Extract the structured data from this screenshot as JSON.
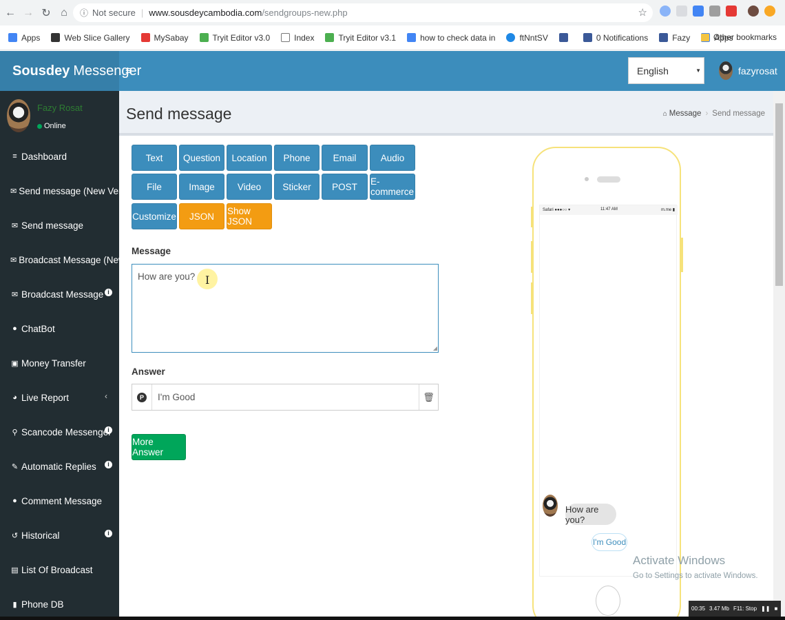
{
  "browser": {
    "security": "Not secure",
    "host": "www.sousdeycambodia.com",
    "path": "/sendgroups-new.php"
  },
  "bookmarks": [
    {
      "label": "Apps",
      "color": "#4285f4"
    },
    {
      "label": "Web Slice Gallery",
      "color": "#333333"
    },
    {
      "label": "MySabay",
      "color": "#e53935"
    },
    {
      "label": "Tryit Editor v3.0",
      "color": "#4caf50"
    },
    {
      "label": "Index",
      "color": "#ffffff"
    },
    {
      "label": "Tryit Editor v3.1",
      "color": "#4caf50"
    },
    {
      "label": "how to check data in",
      "color": "#4285f4"
    },
    {
      "label": "ftNntSV",
      "color": "#1e88e5"
    },
    {
      "label": "",
      "color": "#3b5998"
    },
    {
      "label": "0 Notifications",
      "color": "#3b5998"
    },
    {
      "label": "Fazy",
      "color": "#3b5998"
    },
    {
      "label": "Apps",
      "color": "#4285f4"
    }
  ],
  "other_bookmarks": "Other bookmarks",
  "header": {
    "logo_bold": "Sousdey",
    "logo_rest": "Messenger",
    "language": "English",
    "username": "fazyrosat"
  },
  "sidebar": {
    "user_name": "Fazy Rosat",
    "status": "Online",
    "items": [
      {
        "label": "Dashboard",
        "icon": "≡"
      },
      {
        "label": "Send message (New Version)",
        "icon": "✉"
      },
      {
        "label": "Send message",
        "icon": "✉"
      },
      {
        "label": "Broadcast Message (New Vers",
        "icon": "✉"
      },
      {
        "label": "Broadcast Message",
        "icon": "✉"
      },
      {
        "label": "ChatBot",
        "icon": "●"
      },
      {
        "label": "Money Transfer",
        "icon": "▣"
      },
      {
        "label": "Live Report",
        "icon": "◕"
      },
      {
        "label": "Scancode Messenger",
        "icon": "⚲"
      },
      {
        "label": "Automatic Replies",
        "icon": "✎"
      },
      {
        "label": "Comment Message",
        "icon": "●"
      },
      {
        "label": "Historical",
        "icon": "↺"
      },
      {
        "label": "List Of Broadcast",
        "icon": "▤"
      },
      {
        "label": "Phone DB",
        "icon": "▮"
      }
    ]
  },
  "page": {
    "title": "Send message",
    "breadcrumb_home": "Message",
    "breadcrumb_current": "Send message"
  },
  "buttons": {
    "row1": [
      "Text",
      "Question",
      "Location",
      "Phone",
      "Email",
      "Audio"
    ],
    "row2": [
      "File",
      "Image",
      "Video",
      "Sticker",
      "POST",
      "E-commerce"
    ],
    "row3": [
      "Customize",
      "JSON",
      "Show JSON"
    ]
  },
  "form": {
    "message_label": "Message",
    "message_value": "How are you?",
    "answer_label": "Answer",
    "answer_value": "I'm Good",
    "more_answer": "More Answer"
  },
  "phone": {
    "status_left": "Safari ●●●○○ ▾",
    "status_time": "11:47 AM",
    "status_right": "m.me ▮",
    "bubble": "How are you?",
    "quick_reply": "I'm Good"
  },
  "overlay": {
    "activate_title": "Activate Windows",
    "activate_sub": "Go to Settings to activate Windows.",
    "rec_time": "00:35",
    "rec_size": "3.47 Mb",
    "rec_stop": "F11: Stop"
  }
}
